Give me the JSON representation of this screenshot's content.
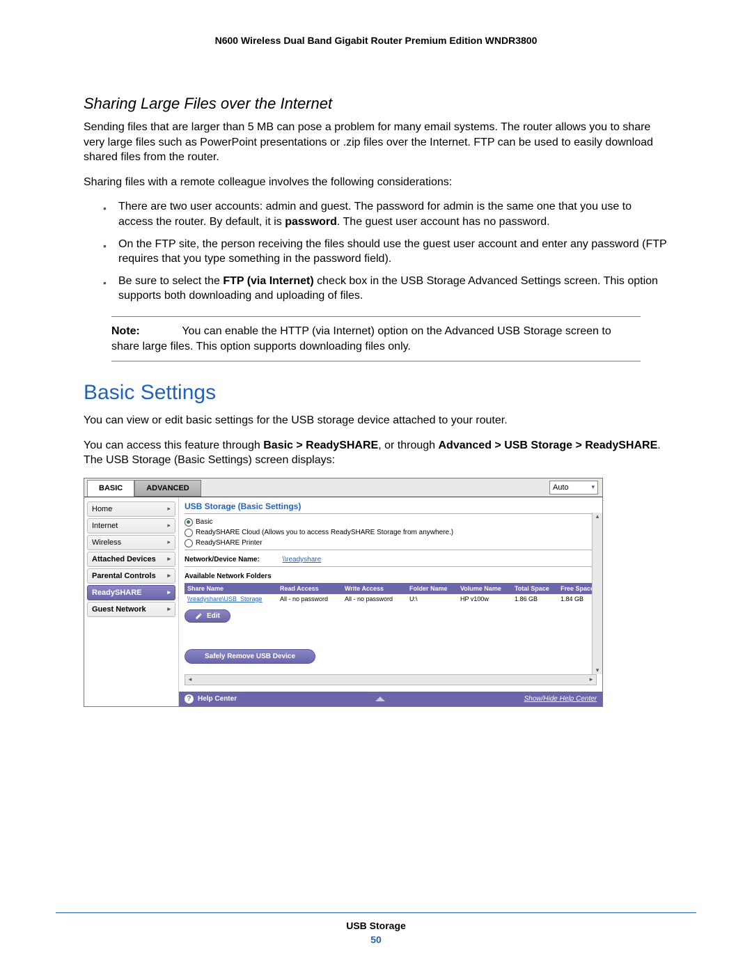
{
  "doc_header": "N600 Wireless Dual Band Gigabit Router Premium Edition WNDR3800",
  "section_title": "Sharing Large Files over the Internet",
  "para1": "Sending files that are larger than 5 MB can pose a problem for many email systems. The router allows you to share very large files such as PowerPoint presentations or .zip files over the Internet. FTP can be used to easily download shared files from the router.",
  "para2": "Sharing files with a remote colleague involves the following considerations:",
  "bullets": {
    "b1a": "There are two user accounts: admin and guest. The password for admin is the same one that you use to access the router. By default, it is ",
    "b1b": "password",
    "b1c": ". The guest user account has no password.",
    "b2": "On the FTP site, the person receiving the files should use the guest user account and enter any password (FTP requires that you type something in the password field).",
    "b3a": "Be sure to select the ",
    "b3b": "FTP (via Internet)",
    "b3c": " check box in the USB Storage Advanced Settings screen. This option supports both downloading and uploading of files."
  },
  "note": {
    "label": "Note:",
    "text": "You can enable the HTTP (via Internet) option on the Advanced USB Storage screen to share large files. This option supports downloading files only."
  },
  "h1": "Basic Settings",
  "para3": "You can view or edit basic settings for the USB storage device attached to your router.",
  "para4": {
    "a": "You can access this feature through ",
    "b": "Basic > ReadySHARE",
    "c": ", or through ",
    "d": "Advanced > USB Storage > ReadySHARE",
    "e": ". The USB Storage (Basic Settings) screen displays:"
  },
  "ui": {
    "tabs": {
      "basic": "BASIC",
      "advanced": "ADVANCED",
      "lang": "Auto"
    },
    "nav": [
      "Home",
      "Internet",
      "Wireless",
      "Attached Devices",
      "Parental Controls",
      "ReadySHARE",
      "Guest Network"
    ],
    "panel": {
      "title": "USB Storage (Basic Settings)",
      "opt1": "Basic",
      "opt2": "ReadySHARE Cloud (Allows you to access ReadySHARE Storage from anywhere.)",
      "opt3": "ReadySHARE Printer",
      "field_label": "Network/Device Name:",
      "field_link": "\\\\readyshare",
      "table_label": "Available Network Folders",
      "headers": [
        "Share Name",
        "Read Access",
        "Write Access",
        "Folder Name",
        "Volume Name",
        "Total Space",
        "Free Space"
      ],
      "row": [
        "\\\\readyshare\\USB_Storage",
        "All - no password",
        "All - no password",
        "U:\\",
        "HP v100w",
        "1.86 GB",
        "1.84 GB"
      ],
      "edit_btn": "Edit",
      "remove_btn": "Safely Remove USB Device",
      "help": "Help Center",
      "help_link": "Show/Hide Help Center"
    }
  },
  "footer": {
    "title": "USB Storage",
    "page": "50"
  }
}
